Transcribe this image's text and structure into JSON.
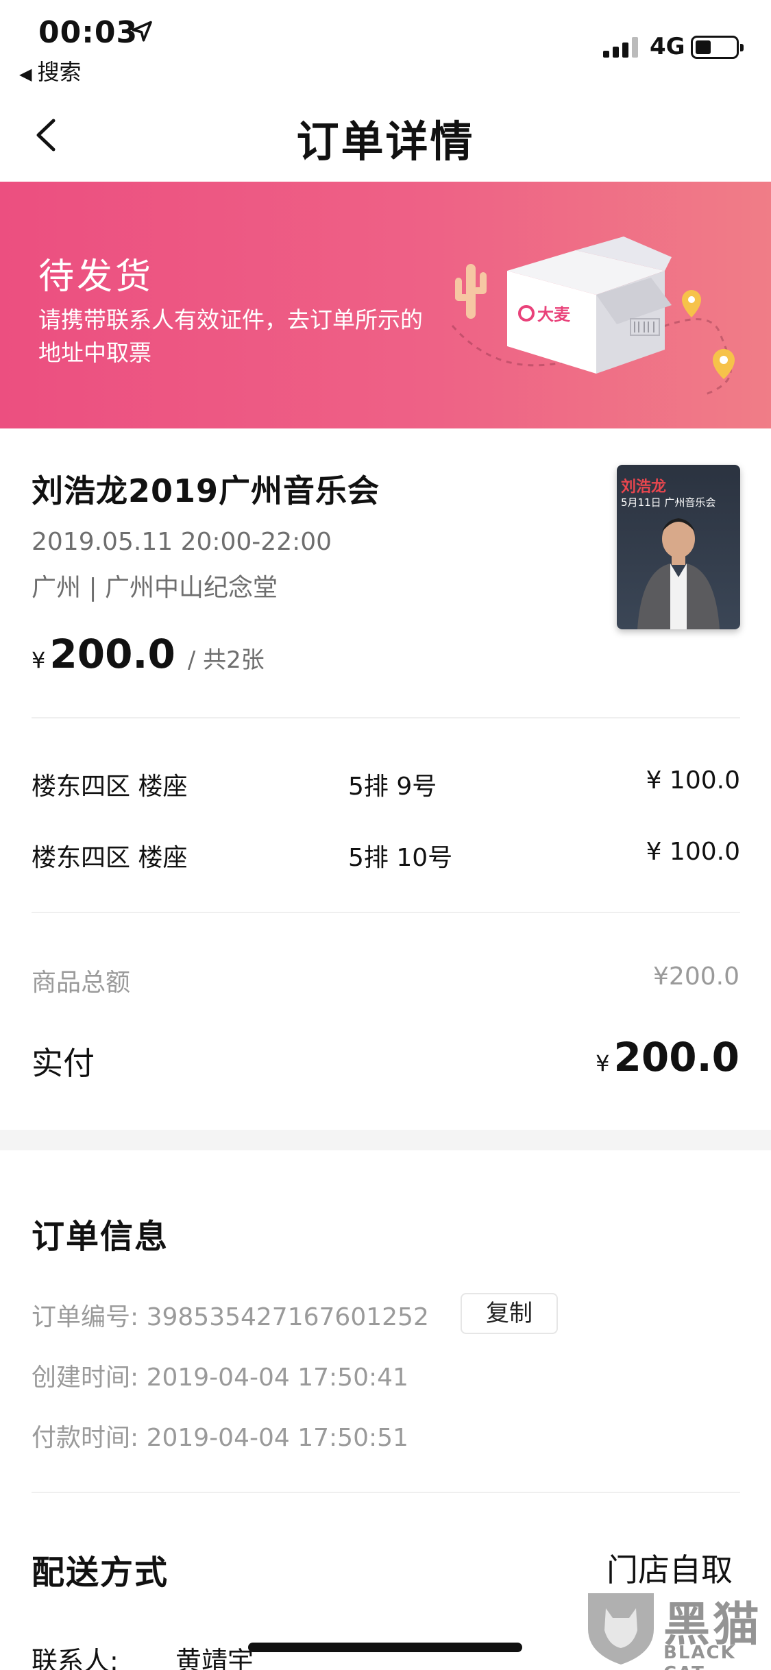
{
  "status_bar": {
    "time": "00:03",
    "back_label": "搜索",
    "network": "4G"
  },
  "nav": {
    "title": "订单详情"
  },
  "banner": {
    "status": "待发货",
    "description": "请携带联系人有效证件，去订单所示的地址中取票",
    "logo_text": "大麦"
  },
  "event": {
    "title": "刘浩龙2019广州音乐会",
    "time": "2019.05.11 20:00-22:00",
    "venue": "广州 | 广州中山纪念堂",
    "currency": "¥",
    "price": "200.0",
    "quantity": "/ 共2张",
    "poster_title": "刘浩龙",
    "poster_subtitle": "5月11日 广州音乐会"
  },
  "tickets": [
    {
      "area": "楼东四区 楼座",
      "seat": "5排 9号",
      "price": "¥ 100.0"
    },
    {
      "area": "楼东四区 楼座",
      "seat": "5排 10号",
      "price": "¥ 100.0"
    }
  ],
  "summary": {
    "goods_total_label": "商品总额",
    "goods_total_value": "¥200.0",
    "paid_label": "实付",
    "paid_currency": "¥",
    "paid_value": "200.0"
  },
  "order_info": {
    "title": "订单信息",
    "order_no": "订单编号: 398535427167601252",
    "copy_label": "复制",
    "created": "创建时间: 2019-04-04 17:50:41",
    "paid": "付款时间: 2019-04-04 17:50:51"
  },
  "delivery": {
    "title": "配送方式",
    "value": "门店自取",
    "contact_label": "联系人:",
    "contact_value": "黄靖宇"
  },
  "watermark": {
    "cn": "黑猫",
    "en": "BLACK CAT"
  },
  "colors": {
    "banner_start": "#ec4f80",
    "banner_end": "#f07d87",
    "muted_text": "#9a9a9a"
  }
}
